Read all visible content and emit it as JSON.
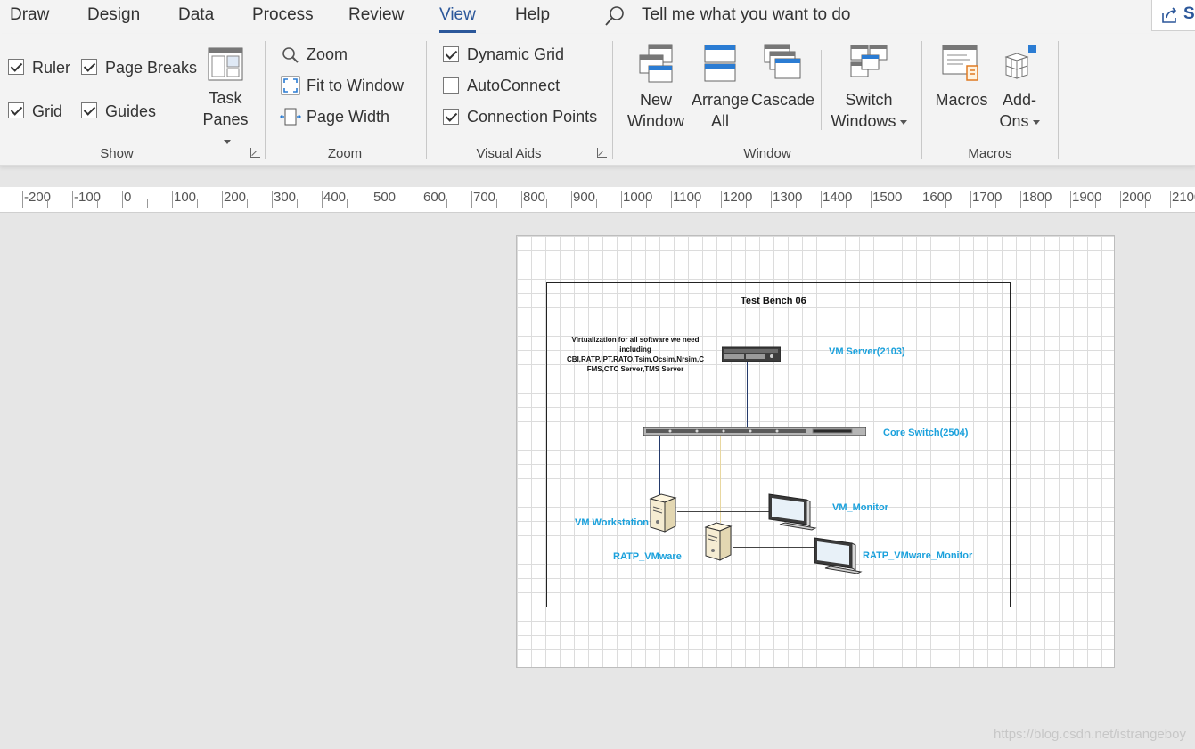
{
  "menu": {
    "tabs": [
      "Draw",
      "Design",
      "Data",
      "Process",
      "Review",
      "View",
      "Help"
    ],
    "active": "View",
    "tell_me": "Tell me what you want to do",
    "share_partial": "Sh"
  },
  "ribbon": {
    "show": {
      "label": "Show",
      "ruler": {
        "label": "Ruler",
        "checked": true
      },
      "page_breaks": {
        "label": "Page Breaks",
        "checked": true
      },
      "grid": {
        "label": "Grid",
        "checked": true
      },
      "guides": {
        "label": "Guides",
        "checked": true
      },
      "task_panes": {
        "line1": "Task",
        "line2": "Panes"
      }
    },
    "zoom": {
      "label": "Zoom",
      "zoom": "Zoom",
      "fit_to_window": "Fit to Window",
      "page_width": "Page Width"
    },
    "visual_aids": {
      "label": "Visual Aids",
      "dynamic_grid": {
        "label": "Dynamic Grid",
        "checked": true
      },
      "autoconnect": {
        "label": "AutoConnect",
        "checked": false
      },
      "connection_points": {
        "label": "Connection Points",
        "checked": true
      }
    },
    "window": {
      "label": "Window",
      "new_window": {
        "line1": "New",
        "line2": "Window"
      },
      "arrange_all": {
        "line1": "Arrange",
        "line2": "All"
      },
      "cascade": "Cascade",
      "switch_windows": {
        "line1": "Switch",
        "line2": "Windows"
      }
    },
    "macros": {
      "label": "Macros",
      "macros": "Macros",
      "add_ons": {
        "line1": "Add-",
        "line2": "Ons"
      }
    }
  },
  "ruler": {
    "labels": [
      "-200",
      "-100",
      "0",
      "100",
      "200",
      "300",
      "400",
      "500",
      "600",
      "700",
      "800",
      "900",
      "1000",
      "1100",
      "1200",
      "1300",
      "1400",
      "1500",
      "1600",
      "1700",
      "1800",
      "1900",
      "2000",
      "2100"
    ]
  },
  "diagram": {
    "title": "Test Bench 06",
    "description": [
      "Virtualization for all software we need",
      "including",
      "CBI,RATP,IPT,RATO,Tsim,Ocsim,Nrsim,C",
      "FMS,CTC Server,TMS Server"
    ],
    "vm_server": "VM Server(2103)",
    "core_switch": "Core Switch(2504)",
    "vm_workstation": "VM Workstation",
    "vm_monitor": "VM_Monitor",
    "ratp_vmware": "RATP_VMware",
    "ratp_vmware_monitor": "RATP_VMware_Monitor"
  },
  "watermark": "https://blog.csdn.net/istrangeboy",
  "colors": {
    "accent": "#2b579a",
    "diagram_label": "#1ba1dc"
  }
}
